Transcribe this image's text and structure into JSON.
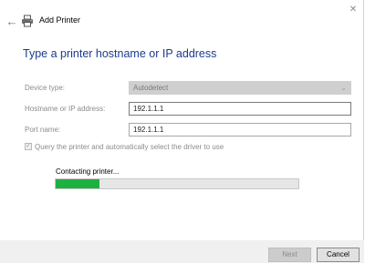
{
  "window": {
    "title": "Add Printer",
    "back_icon": "arrow-left-icon",
    "close_icon": "close-icon",
    "close_glyph": "✕",
    "back_glyph": "←"
  },
  "heading": "Type a printer hostname or IP address",
  "form": {
    "device_type_label": "Device type:",
    "device_type_value": "Autodetect",
    "hostname_label": "Hostname or IP address:",
    "hostname_value": "192.1.1.1",
    "port_label": "Port name:",
    "port_value": "192.1.1.1",
    "query_label": "Query the printer and automatically select the driver to use",
    "query_checked": true
  },
  "progress": {
    "status": "Contacting printer...",
    "value": 0.18,
    "color": "#1eb141"
  },
  "buttons": {
    "next": "Next",
    "cancel": "Cancel"
  },
  "colors": {
    "heading": "#1b3c8c"
  }
}
